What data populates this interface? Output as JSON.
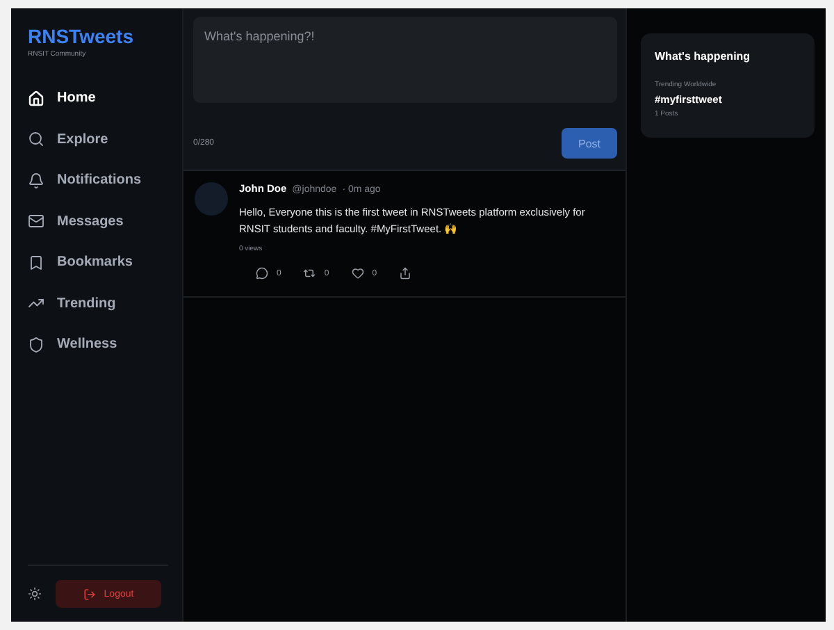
{
  "brand": {
    "title": "RNSTweets",
    "subtitle": "RNSIT Community"
  },
  "nav": [
    {
      "label": "Home",
      "selected": true
    },
    {
      "label": "Explore",
      "selected": false
    },
    {
      "label": "Notifications",
      "selected": false
    },
    {
      "label": "Messages",
      "selected": false
    },
    {
      "label": "Bookmarks",
      "selected": false
    },
    {
      "label": "Trending",
      "selected": false
    },
    {
      "label": "Wellness",
      "selected": false
    }
  ],
  "logout": "Logout",
  "composer": {
    "placeholder": "What's happening?!",
    "counter": "0/280",
    "button": "Post"
  },
  "tweets": [
    {
      "name": "John Doe",
      "handle": "@johndoe",
      "time": "· 0m ago",
      "text": "Hello, Everyone this is the first tweet in RNSTweets platform exclusively for RNSIT students and faculty. #MyFirstTweet. 🙌",
      "views": "0 views",
      "actions": [
        {
          "kind": "reply",
          "count": "0"
        },
        {
          "kind": "retweet",
          "count": "0"
        },
        {
          "kind": "like",
          "count": "0"
        },
        {
          "kind": "share"
        }
      ]
    }
  ],
  "trends": {
    "title": "What's happening",
    "items": [
      {
        "context": "Trending Worldwide",
        "tag": "#myfirsttweet",
        "posts": "1 Posts"
      }
    ]
  }
}
